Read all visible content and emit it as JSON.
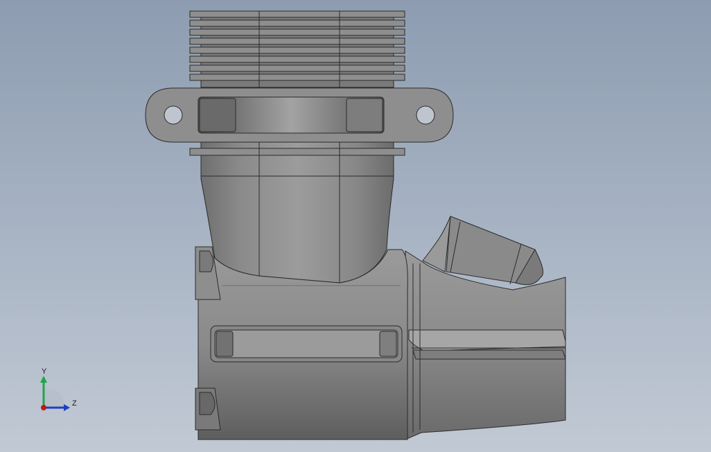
{
  "viewport": {
    "background_top": "#8d9cb1",
    "background_bottom": "#c1c9d4"
  },
  "model": {
    "name": "engine-crankcase-with-finned-cylinder",
    "body_color": "#8e8e8e",
    "edge_color": "#2a2a2a"
  },
  "triad": {
    "y_label": "Y",
    "z_label": "Z",
    "y_color": "#1fa64a",
    "z_color": "#1f3fc2",
    "origin_color": "#c01818"
  }
}
